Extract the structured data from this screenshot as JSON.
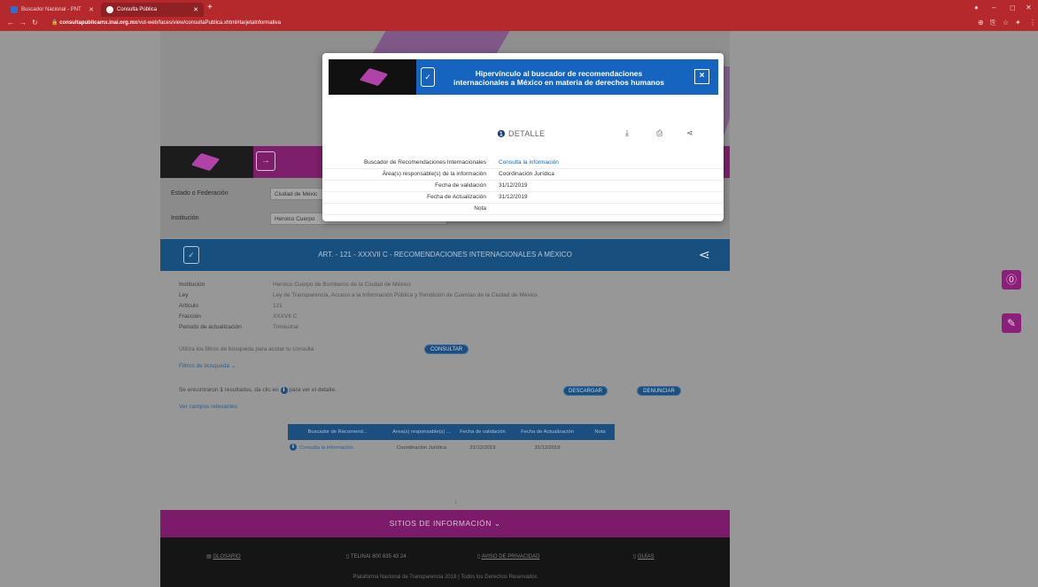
{
  "browser": {
    "tabs": [
      {
        "label": "Buscador Nacional - PNT",
        "active": false
      },
      {
        "label": "Consulta Pública",
        "active": true
      }
    ],
    "new_tab": "+",
    "url_host": "consultapublicamx.inai.org.mx",
    "url_path": "/vut-web/faces/view/consultaPublica.xhtml#tarjetaInformativa",
    "lock_glyph": "🔒"
  },
  "filters": {
    "estado_label": "Estado o Federación",
    "estado_value": "Ciudad de Méxic",
    "institucion_label": "Institución",
    "institucion_value": "Heroico Cuerpo"
  },
  "banner": {
    "title": "ART. - 121 - XXXVII C - RECOMENDACIONES INTERNACIONALES A MÉXICO"
  },
  "info": {
    "rows": [
      {
        "label": "Institución",
        "value": "Heroico Cuerpo de Bomberos de la Ciudad de México"
      },
      {
        "label": "Ley",
        "value": "Ley de Transparencia, Acceso a la Información Pública y Rendición de Cuentas de la Ciudad de México"
      },
      {
        "label": "Artículo",
        "value": "121"
      },
      {
        "label": "Fracción",
        "value": "XXXVII C"
      },
      {
        "label": "Periodo de actualización",
        "value": "Trimestral"
      }
    ],
    "filter_hint": "Utiliza los filtros de búsqueda para acotar tu consulta",
    "consultar": "CONSULTAR",
    "filtros_link": "Filtros de búsqueda",
    "results_prefix": "Se encontraron ",
    "results_count": "1",
    "results_mid": " resultados, da clic en ",
    "results_suffix": " para ver el detalle.",
    "descargar": "DESCARGAR",
    "denunciar": "DENUNCIAR",
    "campos_link": "Ver campos relevantes"
  },
  "results_table": {
    "headers": [
      "Buscador de Recomend...",
      "Área(s) responsable(s) ...",
      "Fecha de validación",
      "Fecha de Actualización",
      "Nota"
    ],
    "row": [
      "Consulta la información",
      "Coordinación Jurídica",
      "31/12/2019",
      "31/12/2019",
      ""
    ]
  },
  "pagination": "1",
  "footer": {
    "sitios": "SITIOS DE INFORMACIÓN",
    "glosario": "GLOSARIO",
    "telinai": "TELINAI 800 835 43 24",
    "aviso": "AVISO DE PRIVACIDAD",
    "guias": "GUÍAS",
    "copyright": "Plataforma Nacional de Transparencia 2019 | Todos los Derechos Reservados"
  },
  "modal": {
    "title_line1": "Hipervínculo al buscador de recomendaciones",
    "title_line2": "internacionales a México en materia de derechos humanos",
    "close": "×",
    "detalle": "DETALLE",
    "rows": [
      {
        "label": "Buscador de Recomendaciones Internacionales",
        "value": "Consulta la información",
        "link": true
      },
      {
        "label": "Área(s) responsable(s) de la información",
        "value": "Coordinación Jurídica",
        "link": false
      },
      {
        "label": "Fecha de validación",
        "value": "31/12/2019",
        "link": false
      },
      {
        "label": "Fecha de Actualización",
        "value": "31/12/2019",
        "link": false
      },
      {
        "label": "Nota",
        "value": "",
        "link": false
      }
    ]
  },
  "colors": {
    "chrome": "#b5282c",
    "purple": "#7d1f6b",
    "blue": "#1565c0",
    "dark_blue": "#174f7f"
  }
}
